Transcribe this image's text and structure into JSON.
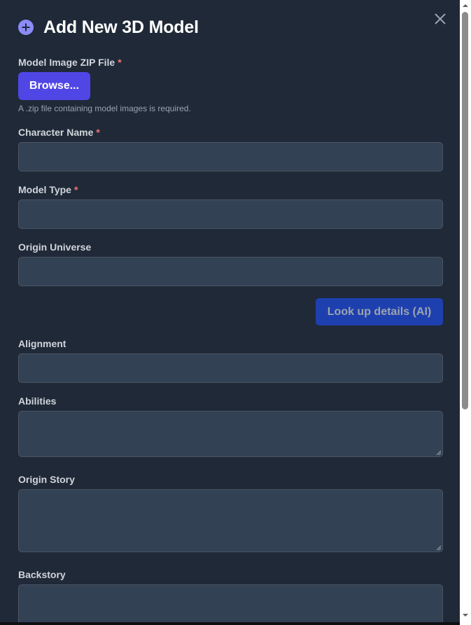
{
  "modal": {
    "title": "Add New 3D Model",
    "title_icon": "plus-circle-icon",
    "close_icon": "close-icon"
  },
  "zip_field": {
    "label": "Model Image ZIP File",
    "required_marker": "*",
    "browse_label": "Browse...",
    "help_text": "A .zip file containing model images is required."
  },
  "fields": {
    "character_name": {
      "label": "Character Name",
      "required_marker": "*",
      "value": ""
    },
    "model_type": {
      "label": "Model Type",
      "required_marker": "*",
      "value": ""
    },
    "origin_universe": {
      "label": "Origin Universe",
      "value": ""
    },
    "alignment": {
      "label": "Alignment",
      "value": ""
    },
    "abilities": {
      "label": "Abilities",
      "value": ""
    },
    "origin_story": {
      "label": "Origin Story",
      "value": ""
    },
    "backstory": {
      "label": "Backstory",
      "value": ""
    }
  },
  "ai_lookup": {
    "label": "Look up details (AI)"
  },
  "colors": {
    "background": "#1f2937",
    "input_bg": "#334155",
    "primary_button": "#5046e5",
    "ai_button": "#1e40af",
    "required": "#f87171"
  }
}
